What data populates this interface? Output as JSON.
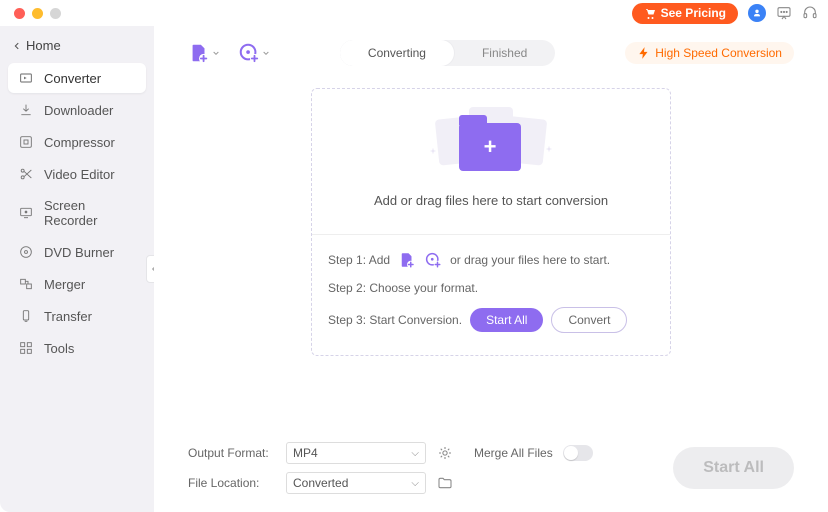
{
  "titlebar": {
    "pricing_label": "See Pricing"
  },
  "sidebar": {
    "back_label": "Home",
    "items": [
      {
        "label": "Converter"
      },
      {
        "label": "Downloader"
      },
      {
        "label": "Compressor"
      },
      {
        "label": "Video Editor"
      },
      {
        "label": "Screen Recorder"
      },
      {
        "label": "DVD Burner"
      },
      {
        "label": "Merger"
      },
      {
        "label": "Transfer"
      },
      {
        "label": "Tools"
      }
    ]
  },
  "toolbar": {
    "tab_converting": "Converting",
    "tab_finished": "Finished",
    "high_speed": "High Speed Conversion"
  },
  "dropzone": {
    "caption": "Add or drag files here to start conversion",
    "step1_pre": "Step 1: Add",
    "step1_post": "or drag your files here to start.",
    "step2": "Step 2: Choose your format.",
    "step3": "Step 3: Start Conversion.",
    "btn_start_all": "Start  All",
    "btn_convert": "Convert"
  },
  "bottom": {
    "output_format_label": "Output Format:",
    "output_format_value": "MP4",
    "file_location_label": "File Location:",
    "file_location_value": "Converted",
    "merge_label": "Merge All Files",
    "start_all": "Start All"
  },
  "colors": {
    "accent_purple": "#8e6cf0",
    "accent_orange": "#ff6a00",
    "pricing_bg": "#ff5a1f"
  }
}
